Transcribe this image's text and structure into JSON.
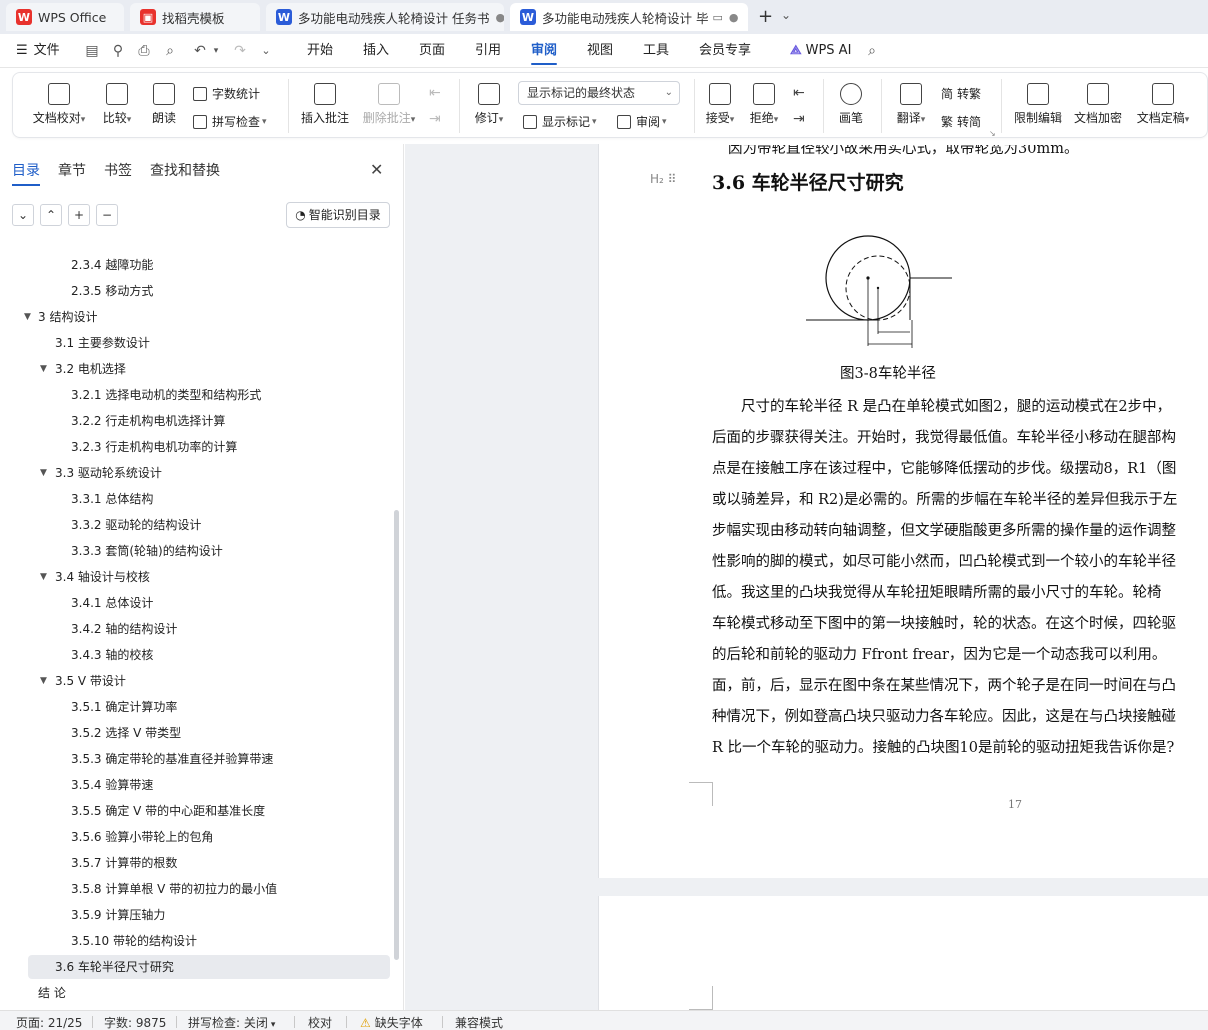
{
  "tabs": [
    {
      "label": "WPS Office",
      "logo": "W",
      "color": "#e8322d",
      "close": ""
    },
    {
      "label": "找稻壳模板",
      "logo": "稻",
      "color": "#e8322d",
      "close": ""
    },
    {
      "label": "多功能电动残疾人轮椅设计 任务书",
      "logo": "W",
      "color": "#2b5cd8",
      "close": "●"
    },
    {
      "label": "多功能电动残疾人轮椅设计 毕",
      "logo": "W",
      "color": "#2b5cd8",
      "close": "●"
    }
  ],
  "tabbar": {
    "new_tab": "+",
    "more": "⌄"
  },
  "menu": {
    "file": "文件",
    "items": [
      "开始",
      "插入",
      "页面",
      "引用",
      "审阅",
      "视图",
      "工具",
      "会员专享"
    ],
    "active_index": 4,
    "ai": "WPS AI"
  },
  "ribbon": {
    "doc_check": "文档校对",
    "compare": "比较",
    "read_aloud": "朗读",
    "word_count": "字数统计",
    "spell_check": "拼写检查",
    "insert_comment": "插入批注",
    "delete_comment": "删除批注",
    "revise": "修订",
    "markup_state": "显示标记的最终状态",
    "show_markup": "显示标记",
    "review": "审阅",
    "accept": "接受",
    "reject": "拒绝",
    "pen": "画笔",
    "translate": "翻译",
    "to_traditional": "转繁",
    "to_simplified": "转简",
    "restrict_edit": "限制编辑",
    "encrypt": "文档加密",
    "finalize": "文档定稿"
  },
  "nav": {
    "tabs": [
      "目录",
      "章节",
      "书签",
      "查找和替换"
    ],
    "smart_toc": "智能识别目录",
    "toc": [
      {
        "label": "2.3.4  越障功能",
        "level": 3,
        "tri": ""
      },
      {
        "label": "2.3.5  移动方式",
        "level": 3,
        "tri": ""
      },
      {
        "label": "3  结构设计",
        "level": 1,
        "tri": "▼"
      },
      {
        "label": "3.1  主要参数设计",
        "level": 2,
        "tri": ""
      },
      {
        "label": "3.2  电机选择",
        "level": 2,
        "tri": "▼"
      },
      {
        "label": "3.2.1  选择电动机的类型和结构形式",
        "level": 3,
        "tri": ""
      },
      {
        "label": "3.2.2  行走机构电机选择计算",
        "level": 3,
        "tri": ""
      },
      {
        "label": "3.2.3  行走机构电机功率的计算",
        "level": 3,
        "tri": ""
      },
      {
        "label": "3.3  驱动轮系统设计",
        "level": 2,
        "tri": "▼"
      },
      {
        "label": "3.3.1  总体结构",
        "level": 3,
        "tri": ""
      },
      {
        "label": "3.3.2  驱动轮的结构设计",
        "level": 3,
        "tri": ""
      },
      {
        "label": "3.3.3 套筒(轮轴)的结构设计",
        "level": 3,
        "tri": ""
      },
      {
        "label": "3.4  轴设计与校核",
        "level": 2,
        "tri": "▼"
      },
      {
        "label": "3.4.1  总体设计",
        "level": 3,
        "tri": ""
      },
      {
        "label": "3.4.2  轴的结构设计",
        "level": 3,
        "tri": ""
      },
      {
        "label": "3.4.3  轴的校核",
        "level": 3,
        "tri": ""
      },
      {
        "label": "3.5 V 带设计",
        "level": 2,
        "tri": "▼"
      },
      {
        "label": "3.5.1 确定计算功率",
        "level": 3,
        "tri": ""
      },
      {
        "label": "3.5.2  选择 V 带类型",
        "level": 3,
        "tri": ""
      },
      {
        "label": "3.5.3 确定带轮的基准直径并验算带速",
        "level": 3,
        "tri": ""
      },
      {
        "label": "3.5.4 验算带速",
        "level": 3,
        "tri": ""
      },
      {
        "label": "3.5.5 确定 V 带的中心距和基准长度",
        "level": 3,
        "tri": ""
      },
      {
        "label": "3.5.6 验算小带轮上的包角",
        "level": 3,
        "tri": ""
      },
      {
        "label": "3.5.7  计算带的根数",
        "level": 3,
        "tri": ""
      },
      {
        "label": "3.5.8  计算单根 V 带的初拉力的最小值",
        "level": 3,
        "tri": ""
      },
      {
        "label": "3.5.9  计算压轴力",
        "level": 3,
        "tri": ""
      },
      {
        "label": "3.5.10  带轮的结构设计",
        "level": 3,
        "tri": ""
      },
      {
        "label": "3.6  车轮半径尺寸研究",
        "level": 2,
        "tri": "",
        "selected": true
      },
      {
        "label": "结   论",
        "level": 1,
        "tri": ""
      }
    ]
  },
  "document": {
    "top_partial": "因为带轮直径较小故采用实心式，取带轮宽为30mm。",
    "heading_mark": "H₂ ⠿",
    "heading": "3.6  车轮半径尺寸研究",
    "figure_caption": "图3-8车轮半径",
    "lines": [
      "　　尺寸的车轮半径 R 是凸在单轮模式如图2，腿的运动模式在2步中，",
      "后面的步骤获得关注。开始时，我觉得最低值。车轮半径小移动在腿部构",
      "点是在接触工序在该过程中，它能够降低摆动的步伐。级摆动8，R1（图",
      "或以骑差异，和 R2)是必需的。所需的步幅在车轮半径的差异但我示于左",
      "步幅实现由移动转向轴调整，但文学硬脂酸更多所需的操作量的运作调整",
      "性影响的脚的模式，如尽可能小然而，凹凸轮模式到一个较小的车轮半径",
      "低。我这里的凸块我觉得从车轮扭矩眼睛所需的最小尺寸的车轮。轮椅",
      "车轮模式移动至下图中的第一块接触时，轮的状态。在这个时候，四轮驱",
      "的后轮和前轮的驱动力 Ffront frear，因为它是一个动态我可以利用。",
      "面，前，后，显示在图中条在某些情况下，两个轮子是在同一时间在与凸",
      "种情况下，例如登高凸块只驱动力各车轮应。因此，这是在与凸块接触碰",
      "R 比一个车轮的驱动力。接触的凸块图10是前轮的驱动扭矩我告诉你是?"
    ],
    "page_number": "17"
  },
  "status": {
    "page": "页面: 21/25",
    "words": "字数: 9875",
    "spell": "拼写检查: 关闭",
    "proof": "校对",
    "missing_font": "缺失字体",
    "compat": "兼容模式"
  }
}
